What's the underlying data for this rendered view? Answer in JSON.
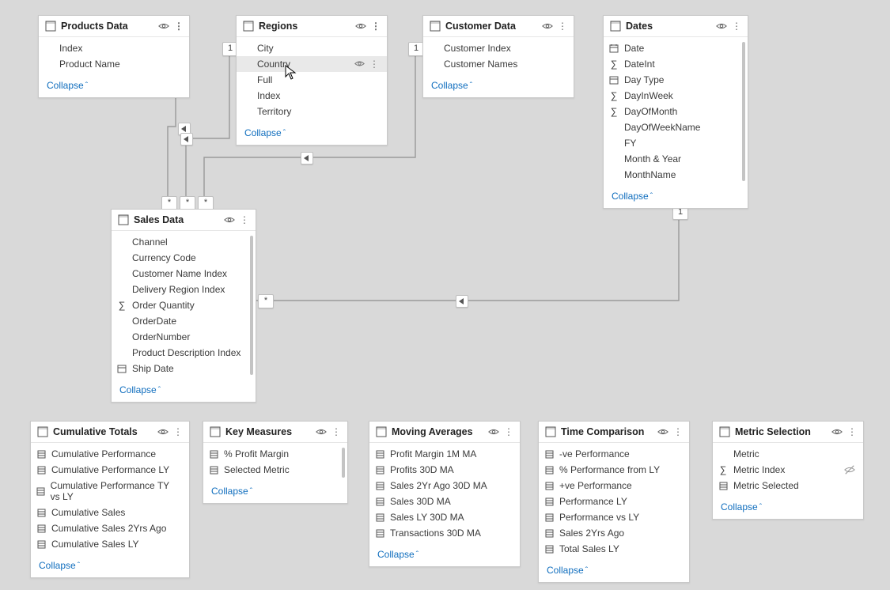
{
  "collapseLabel": "Collapse",
  "tables": {
    "products": {
      "title": "Products Data",
      "fields": [
        {
          "label": "Index"
        },
        {
          "label": "Product Name"
        }
      ]
    },
    "regions": {
      "title": "Regions",
      "fields": [
        {
          "label": "City"
        },
        {
          "label": "Country",
          "selected": true,
          "showRowActions": true
        },
        {
          "label": "Full"
        },
        {
          "label": "Index"
        },
        {
          "label": "Territory"
        }
      ]
    },
    "customer": {
      "title": "Customer Data",
      "fields": [
        {
          "label": "Customer Index"
        },
        {
          "label": "Customer Names"
        }
      ]
    },
    "dates": {
      "title": "Dates",
      "fields": [
        {
          "label": "Date",
          "icon": "calendar"
        },
        {
          "label": "DateInt",
          "icon": "sigma"
        },
        {
          "label": "Day Type",
          "icon": "calendar"
        },
        {
          "label": "DayInWeek",
          "icon": "sigma"
        },
        {
          "label": "DayOfMonth",
          "icon": "sigma"
        },
        {
          "label": "DayOfWeekName"
        },
        {
          "label": "FY"
        },
        {
          "label": "Month & Year"
        },
        {
          "label": "MonthName"
        }
      ]
    },
    "sales": {
      "title": "Sales Data",
      "fields": [
        {
          "label": "Channel"
        },
        {
          "label": "Currency Code"
        },
        {
          "label": "Customer Name Index"
        },
        {
          "label": "Delivery Region Index"
        },
        {
          "label": "Order Quantity",
          "icon": "sigma"
        },
        {
          "label": "OrderDate"
        },
        {
          "label": "OrderNumber"
        },
        {
          "label": "Product Description Index"
        },
        {
          "label": "Ship Date",
          "icon": "calendar"
        }
      ]
    },
    "cumulative": {
      "title": "Cumulative Totals",
      "fields": [
        {
          "label": "Cumulative Performance",
          "icon": "measure"
        },
        {
          "label": "Cumulative Performance LY",
          "icon": "measure"
        },
        {
          "label": "Cumulative Performance TY vs LY",
          "icon": "measure"
        },
        {
          "label": "Cumulative Sales",
          "icon": "measure"
        },
        {
          "label": "Cumulative Sales 2Yrs Ago",
          "icon": "measure"
        },
        {
          "label": "Cumulative Sales LY",
          "icon": "measure"
        }
      ]
    },
    "keymeasures": {
      "title": "Key Measures",
      "fields": [
        {
          "label": "% Profit Margin",
          "icon": "measure"
        },
        {
          "label": "Selected Metric",
          "icon": "measure"
        }
      ]
    },
    "moving": {
      "title": "Moving Averages",
      "fields": [
        {
          "label": "Profit Margin 1M MA",
          "icon": "measure"
        },
        {
          "label": "Profits 30D MA",
          "icon": "measure"
        },
        {
          "label": "Sales 2Yr Ago 30D MA",
          "icon": "measure"
        },
        {
          "label": "Sales 30D MA",
          "icon": "measure"
        },
        {
          "label": "Sales LY 30D MA",
          "icon": "measure"
        },
        {
          "label": "Transactions 30D MA",
          "icon": "measure"
        }
      ]
    },
    "timecomp": {
      "title": "Time Comparison",
      "fields": [
        {
          "label": "-ve Performance",
          "icon": "measure"
        },
        {
          "label": "% Performance from LY",
          "icon": "measure"
        },
        {
          "label": "+ve Performance",
          "icon": "measure"
        },
        {
          "label": "Performance LY",
          "icon": "measure"
        },
        {
          "label": "Performance vs LY",
          "icon": "measure"
        },
        {
          "label": "Sales 2Yrs Ago",
          "icon": "measure"
        },
        {
          "label": "Total Sales LY",
          "icon": "measure"
        }
      ]
    },
    "metric": {
      "title": "Metric Selection",
      "fields": [
        {
          "label": "Metric"
        },
        {
          "label": "Metric Index",
          "icon": "sigma",
          "trailing": "eye-off"
        },
        {
          "label": "Metric Selected",
          "icon": "measure"
        }
      ]
    }
  },
  "cardinality": {
    "one": "1",
    "many": "*"
  }
}
